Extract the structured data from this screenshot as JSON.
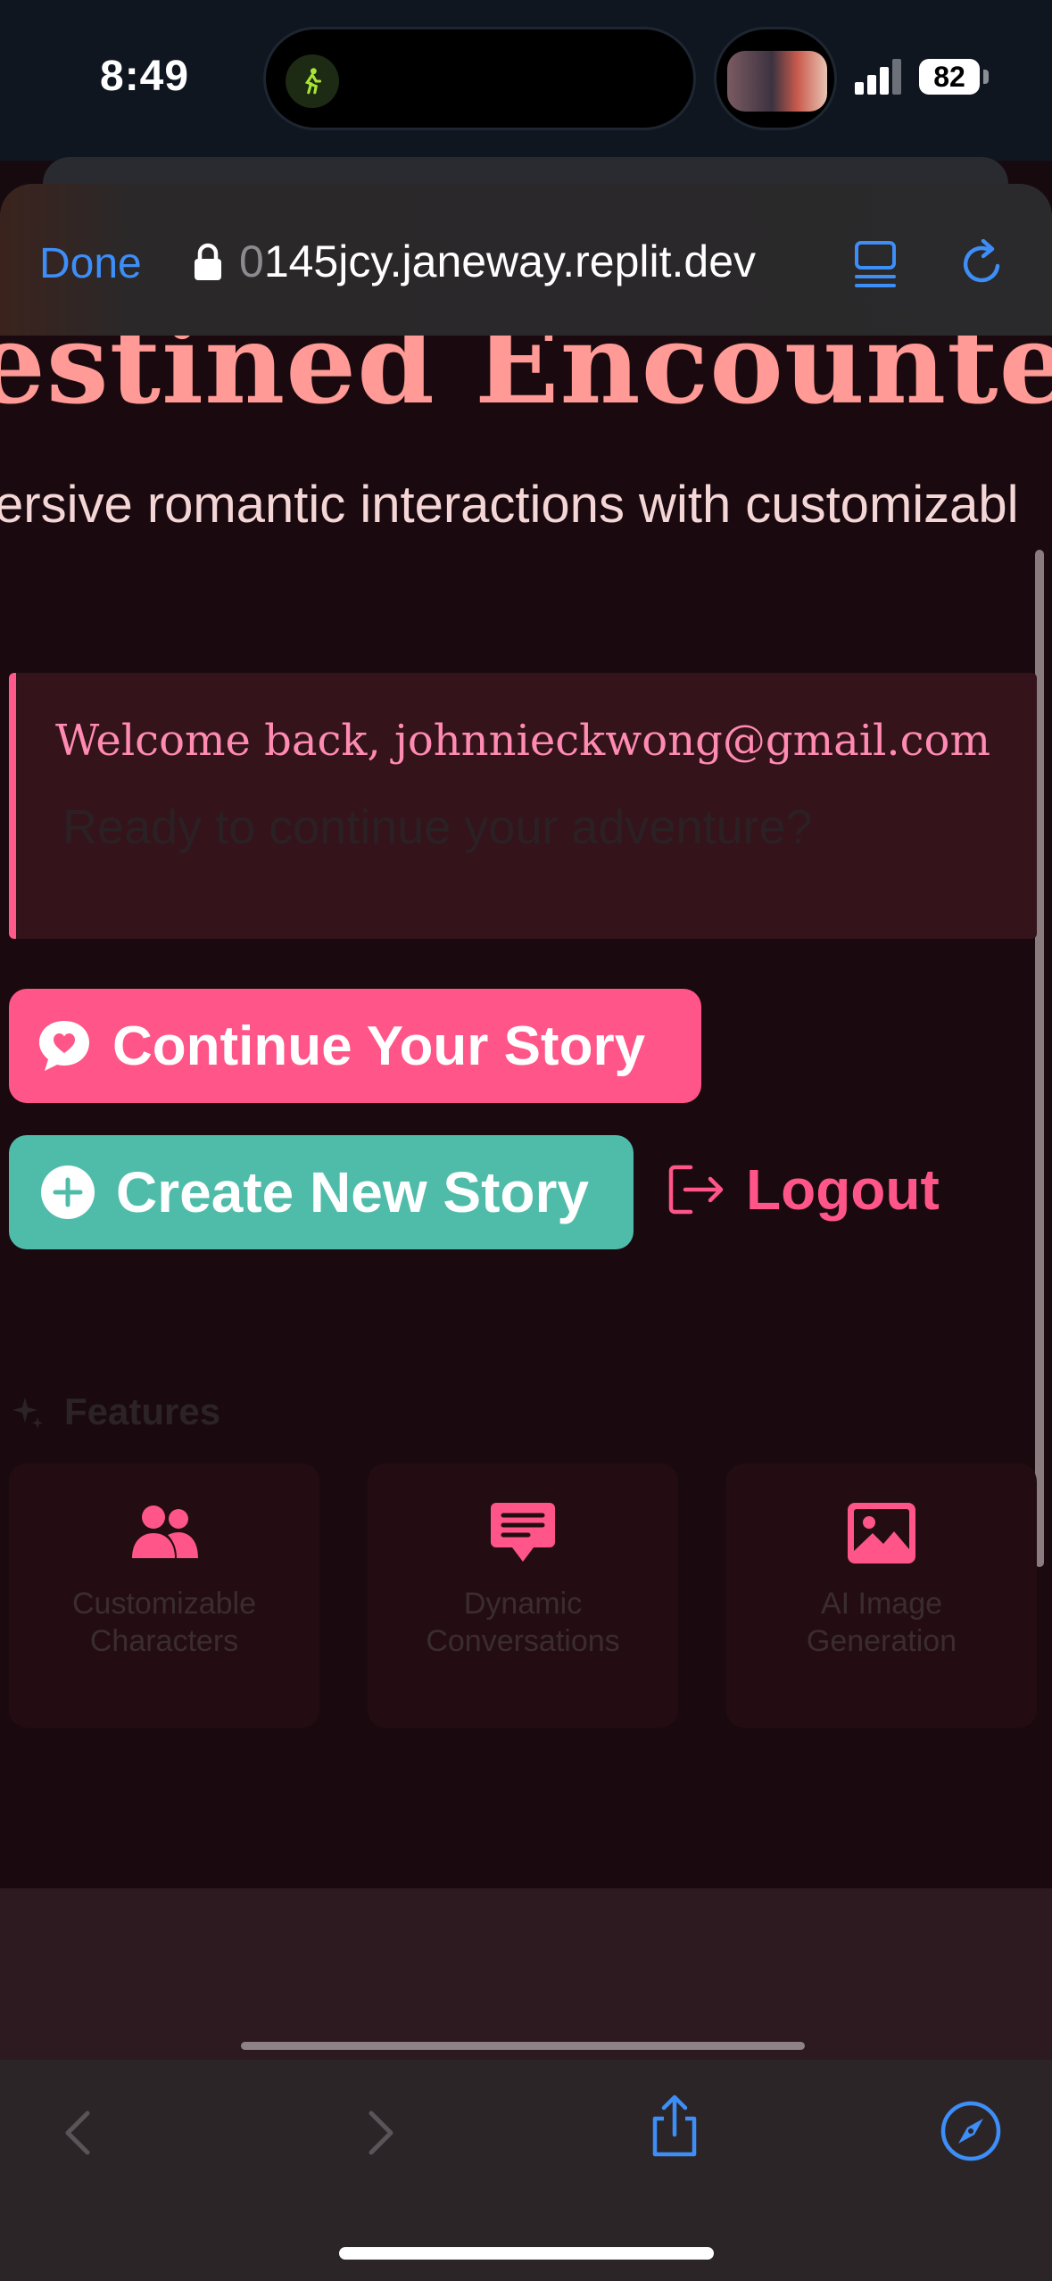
{
  "status_bar": {
    "time": "8:49",
    "battery": "82"
  },
  "browser": {
    "done_label": "Done",
    "url_faded_prefix": "0",
    "url": "145jcy.janeway.replit.dev"
  },
  "hero": {
    "title": "estined Encounte",
    "subtitle": "ersive romantic interactions with customizabl"
  },
  "welcome": {
    "greeting": "Welcome back, johnnieckwong@gmail.com",
    "prompt": "Ready to continue your adventure?"
  },
  "actions": {
    "continue_label": "Continue Your Story",
    "create_label": "Create New Story",
    "logout_label": "Logout"
  },
  "features": {
    "heading": "Features",
    "cards": [
      {
        "line1": "Customizable",
        "line2": "Characters",
        "icon": "users-icon"
      },
      {
        "line1": "Dynamic",
        "line2": "Conversations",
        "icon": "chat-icon"
      },
      {
        "line1": "AI Image",
        "line2": "Generation",
        "icon": "image-icon"
      }
    ]
  },
  "colors": {
    "accent_pink": "#ff5589",
    "accent_teal": "#4fbcaa",
    "title_coral": "#ff9a96",
    "ios_blue": "#3d8ef7"
  }
}
